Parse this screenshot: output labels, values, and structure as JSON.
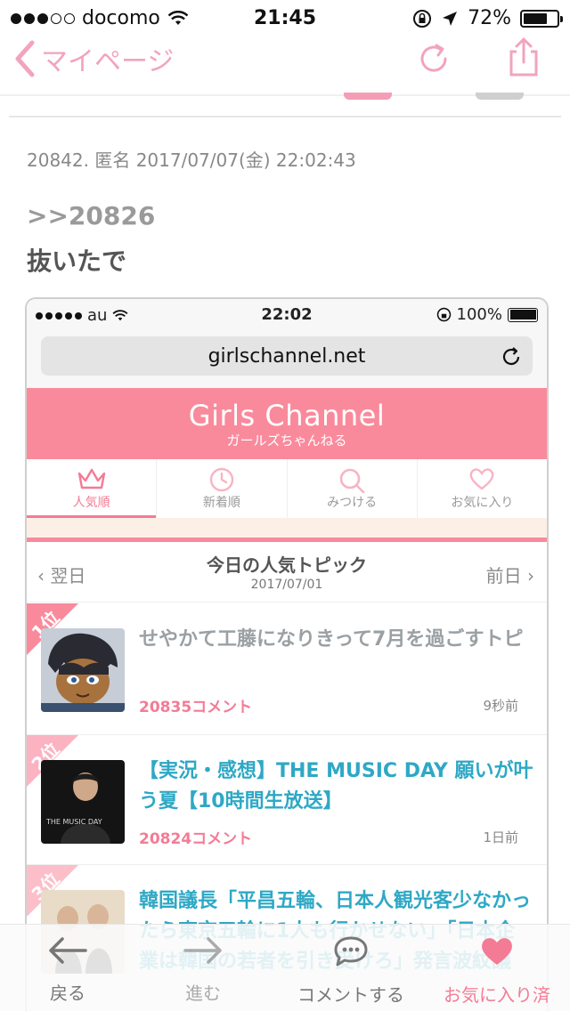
{
  "status_bar": {
    "carrier": "docomo",
    "time": "21:45",
    "battery": "72%",
    "battery_level": 0.72
  },
  "nav": {
    "back_label": "マイページ"
  },
  "post": {
    "meta": "20842. 匿名 2017/07/07(金) 22:02:43",
    "reply": ">>20826",
    "body": "抜いたで"
  },
  "embedded": {
    "status": {
      "carrier": "au",
      "time": "22:02",
      "battery": "100%",
      "battery_level": 1.0
    },
    "url": "girlschannel.net",
    "site": {
      "title": "Girls Channel",
      "subtitle": "ガールズちゃんねる",
      "brand_color": "#f98a9c"
    },
    "tabs": [
      {
        "label": "人気順",
        "icon": "crown-icon",
        "active": true
      },
      {
        "label": "新着順",
        "icon": "clock-icon",
        "active": false
      },
      {
        "label": "みつける",
        "icon": "search-icon",
        "active": false
      },
      {
        "label": "お気に入り",
        "icon": "heart-icon",
        "active": false
      }
    ],
    "day_nav": {
      "prev": "翌日",
      "next": "前日",
      "title": "今日の人気トピック",
      "date": "2017/07/01"
    },
    "topics": [
      {
        "rank": "1位",
        "title": "せやかて工藤になりきって7月を過ごすトピ",
        "comments": "20835コメント",
        "time": "9秒前"
      },
      {
        "rank": "2位",
        "title": "【実況・感想】THE MUSIC DAY 願いが叶う夏【10時間生放送】",
        "comments": "20824コメント",
        "time": "1日前",
        "thumb_text": "THE MUSIC DAY"
      },
      {
        "rank": "3位",
        "title": "韓国議長「平昌五輪、日本人観光客少なかったら東京五輪に1人も行かせない」「日本企業は韓国の若者を引き受けろ」発言波紋議",
        "comments": "",
        "time": ""
      }
    ]
  },
  "toolbar": {
    "back": "戻る",
    "forward": "進む",
    "comment": "コメントする",
    "favorite": "お気に入り済"
  },
  "colors": {
    "accent_pink": "#f47b95",
    "teal_link": "#2ea8c5"
  }
}
